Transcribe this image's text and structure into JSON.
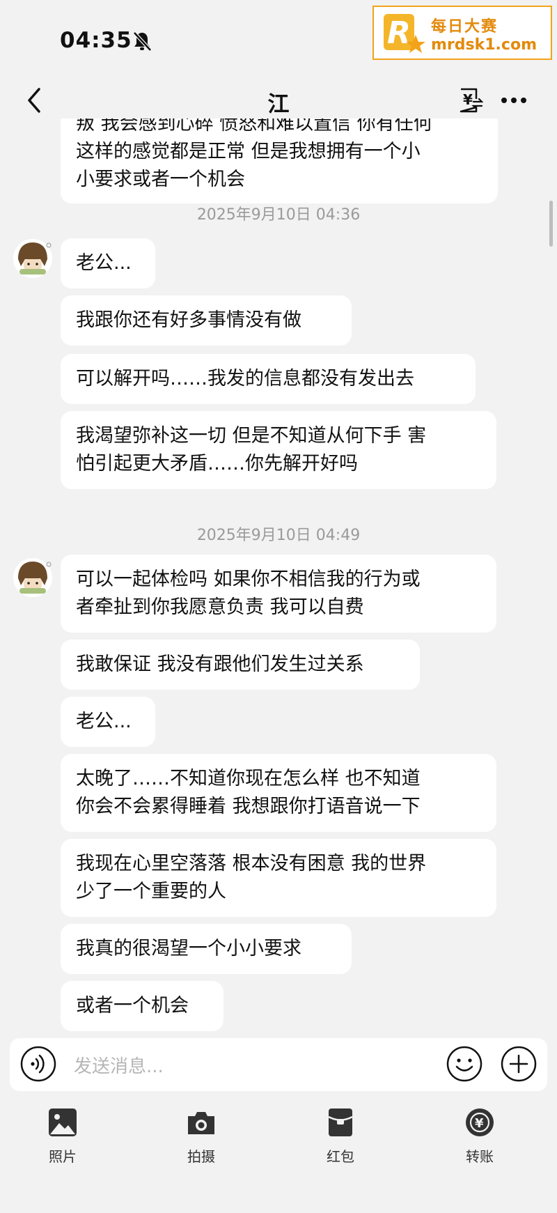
{
  "status": {
    "time": "04:35"
  },
  "watermark": {
    "logo_letter": "R",
    "name": "每日大赛",
    "url": "mrdsk1.com"
  },
  "header": {
    "title": "江"
  },
  "messages": {
    "m0": {
      "lines": [
        "叛 我会感到心碎 愤怒和难以置信 你有任何",
        "这样的感觉都是正常 但是我想拥有一个小",
        "小要求或者一个机会"
      ]
    },
    "ts1": "2025年9月10日 04:36",
    "m1": {
      "lines": [
        "老公..."
      ]
    },
    "m2": {
      "lines": [
        "我跟你还有好多事情没有做"
      ]
    },
    "m3": {
      "lines": [
        "可以解开吗……我发的信息都没有发出去"
      ]
    },
    "m4": {
      "lines": [
        "我渴望弥补这一切 但是不知道从何下手 害",
        "怕引起更大矛盾……你先解开好吗"
      ]
    },
    "ts2": "2025年9月10日 04:49",
    "m5": {
      "lines": [
        "可以一起体检吗 如果你不相信我的行为或",
        "者牵扯到你我愿意负责 我可以自费"
      ]
    },
    "m6": {
      "lines": [
        "我敢保证 我没有跟他们发生过关系"
      ]
    },
    "m7": {
      "lines": [
        "老公..."
      ]
    },
    "m8": {
      "lines": [
        "太晚了……不知道你现在怎么样 也不知道",
        "你会不会累得睡着 我想跟你打语音说一下"
      ]
    },
    "m9": {
      "lines": [
        "我现在心里空落落 根本没有困意 我的世界",
        "少了一个重要的人"
      ]
    },
    "m10": {
      "lines": [
        "我真的很渴望一个小小要求"
      ]
    },
    "m11": {
      "lines": [
        "或者一个机会"
      ]
    }
  },
  "composer": {
    "placeholder": "发送消息..."
  },
  "toolbar": {
    "photo": "照片",
    "camera": "拍摄",
    "red_packet": "红包",
    "transfer": "转账"
  },
  "icons": [
    "bell-muted-icon",
    "back-icon",
    "transfer-money-icon",
    "more-icon",
    "voice-icon",
    "emoji-icon",
    "plus-icon",
    "photo-icon",
    "camera-icon",
    "red-packet-icon",
    "transfer-icon"
  ],
  "colors": {
    "background": "#f2f2f2",
    "bubble": "#ffffff",
    "watermark": "#e38a0c"
  }
}
